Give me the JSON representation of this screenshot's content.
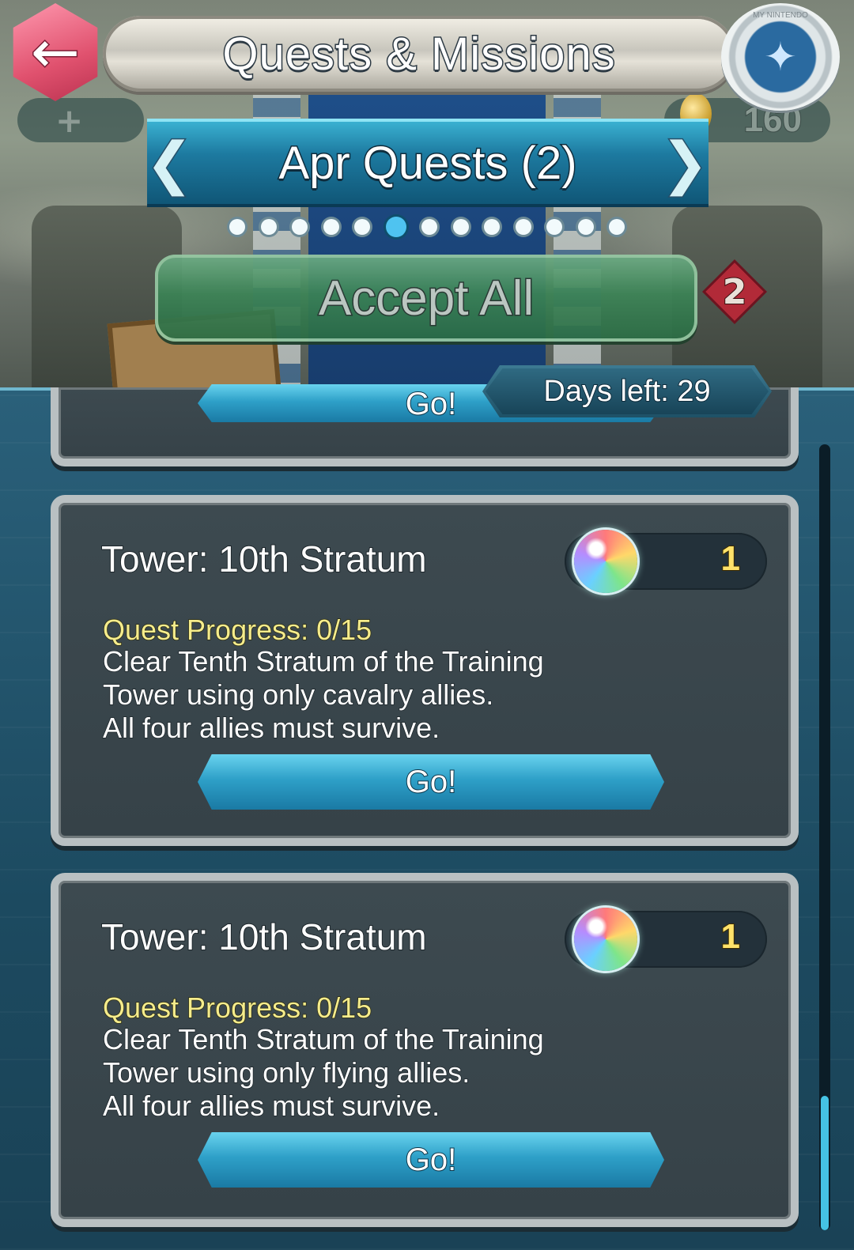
{
  "header": {
    "title": "Quests & Missions",
    "back_icon": "left-arrow-icon",
    "badge_label": "MY NINTENDO",
    "badge_icon": "fire-emblem-crest-icon",
    "orb_count": "160",
    "hero_plus": "+"
  },
  "category": {
    "label": "Apr Quests (2)",
    "page_count": 13,
    "active_index": 5
  },
  "accept_all": {
    "label": "Accept All",
    "count": "2"
  },
  "list": {
    "days_left": "Days left: 29",
    "partial_go_label": "Go!",
    "quests": [
      {
        "title": "Tower: 10th Stratum",
        "reward_icon": "orb-icon",
        "reward_amount": "1",
        "progress": "Quest Progress: 0/15",
        "description_lines": [
          "Clear Tenth Stratum of the Training",
          "Tower using only cavalry allies.",
          "All four allies must survive."
        ],
        "go_label": "Go!"
      },
      {
        "title": "Tower: 10th Stratum",
        "reward_icon": "orb-icon",
        "reward_amount": "1",
        "progress": "Quest Progress: 0/15",
        "description_lines": [
          "Clear Tenth Stratum of the Training",
          "Tower using only flying allies.",
          "All four allies must survive."
        ],
        "go_label": "Go!"
      }
    ]
  },
  "colors": {
    "accent": "#2ea0c8",
    "progress_text": "#f5ec8c",
    "reward_text": "#ffe26a",
    "accept_green": "#3c8456",
    "back_pink": "#e0516e"
  }
}
